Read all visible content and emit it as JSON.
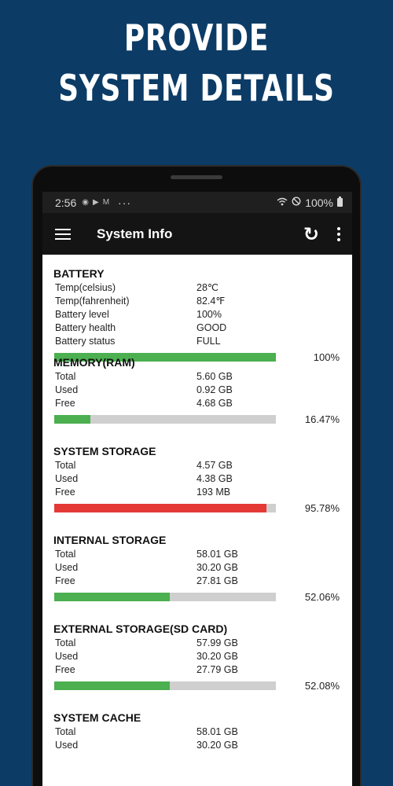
{
  "promo": {
    "line1": "PROVIDE",
    "line2": "SYSTEM DETAILS"
  },
  "statusbar": {
    "time": "2:56",
    "icons": [
      "nav-icon",
      "play-icon",
      "gmail-icon"
    ],
    "more": "···",
    "battery": "100%"
  },
  "appbar": {
    "title": "System Info"
  },
  "colors": {
    "green": "#4caf50",
    "red": "#e53935",
    "track": "#cfcfcf"
  },
  "sections": [
    {
      "title": "BATTERY",
      "rows": [
        {
          "k": "Temp(celsius)",
          "v": "28℃"
        },
        {
          "k": "Temp(fahrenheit)",
          "v": "82.4℉"
        },
        {
          "k": "Battery level",
          "v": "100%"
        },
        {
          "k": "Battery health",
          "v": "GOOD"
        },
        {
          "k": "Battery status",
          "v": "FULL"
        }
      ],
      "percent_label": "100%",
      "fill_fraction": 1.0,
      "fill_color": "green"
    },
    {
      "title": "MEMORY(RAM)",
      "rows": [
        {
          "k": "Total",
          "v": "5.60 GB"
        },
        {
          "k": "Used",
          "v": "0.92 GB"
        },
        {
          "k": "Free",
          "v": "4.68 GB"
        }
      ],
      "percent_label": "16.47%",
      "fill_fraction": 0.1647,
      "fill_color": "green"
    },
    {
      "title": "SYSTEM STORAGE",
      "rows": [
        {
          "k": "Total",
          "v": "4.57 GB"
        },
        {
          "k": "Used",
          "v": "4.38 GB"
        },
        {
          "k": "Free",
          "v": "193 MB"
        }
      ],
      "percent_label": "95.78%",
      "fill_fraction": 0.9578,
      "fill_color": "red"
    },
    {
      "title": "INTERNAL STORAGE",
      "rows": [
        {
          "k": "Total",
          "v": "58.01 GB"
        },
        {
          "k": "Used",
          "v": "30.20 GB"
        },
        {
          "k": "Free",
          "v": "27.81 GB"
        }
      ],
      "percent_label": "52.06%",
      "fill_fraction": 0.5206,
      "fill_color": "green"
    },
    {
      "title": "EXTERNAL STORAGE(SD CARD)",
      "rows": [
        {
          "k": "Total",
          "v": "57.99 GB"
        },
        {
          "k": "Used",
          "v": "30.20 GB"
        },
        {
          "k": "Free",
          "v": "27.79 GB"
        }
      ],
      "percent_label": "52.08%",
      "fill_fraction": 0.5208,
      "fill_color": "green"
    },
    {
      "title": "SYSTEM CACHE",
      "rows": [
        {
          "k": "Total",
          "v": "58.01 GB"
        },
        {
          "k": "Used",
          "v": "30.20 GB"
        }
      ],
      "percent_label": "",
      "fill_fraction": null,
      "fill_color": "green"
    }
  ]
}
